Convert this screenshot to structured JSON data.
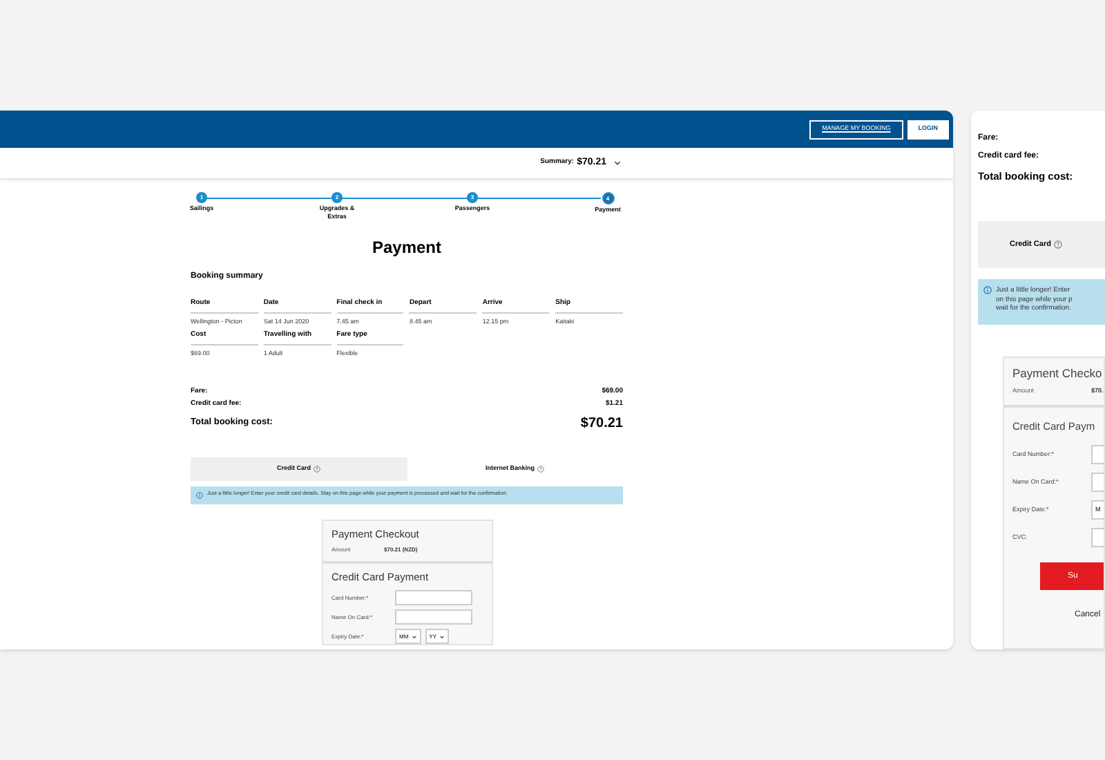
{
  "desktop": {
    "header": {
      "buttons": [
        {
          "label": "MANAGE MY BOOKING",
          "kind": "outline"
        },
        {
          "label": "LOGIN",
          "kind": "solid"
        }
      ]
    },
    "summary": {
      "label": "Summary:",
      "amount": "$70.21"
    },
    "steps": [
      {
        "number": "1",
        "label": "Sailings",
        "selected": false
      },
      {
        "number": "2",
        "label": "Upgrades & Extras",
        "selected": false
      },
      {
        "number": "3",
        "label": "Passengers",
        "selected": false
      },
      {
        "number": "4",
        "label": "Payment",
        "selected": true
      }
    ],
    "title": "Payment",
    "section_title": "Booking summary",
    "details": [
      {
        "label": "Route",
        "value": "Wellington - Picton"
      },
      {
        "label": "Date",
        "value": "Sat 14 Jun 2020"
      },
      {
        "label": "Final check in",
        "value": "7.45 am"
      },
      {
        "label": "Depart",
        "value": "8.45 am"
      },
      {
        "label": "Arrive",
        "value": "12.15 pm"
      },
      {
        "label": "Ship",
        "value": "Kaitaki"
      },
      {
        "label": "Cost",
        "value": "$69.00"
      },
      {
        "label": "Travelling with",
        "value": "1 Adult"
      },
      {
        "label": "Fare type",
        "value": "Flexible"
      }
    ],
    "costs": [
      {
        "label": "Fare:",
        "value": "$69.00",
        "kind": "line"
      },
      {
        "label": "Credit card fee:",
        "value": "$1.21",
        "kind": "line"
      },
      {
        "label": "Total booking cost:",
        "value": "$70.21",
        "kind": "total"
      }
    ],
    "payment_tabs": [
      {
        "label": "Credit Card",
        "selected": true
      },
      {
        "label": "Internet Banking",
        "selected": false
      }
    ],
    "notice": "Just a little longer! Enter your credit card details. Stay on this page while your payment is processed and wait for the confirmation.",
    "checkout": {
      "title": "Payment Checkout",
      "amount_label": "Amount",
      "amount": "$70.21 (NZD)",
      "form_title": "Credit Card Payment",
      "fields": [
        {
          "label": "Card Number:*",
          "kind": "text"
        },
        {
          "label": "Name On Card:*",
          "kind": "text"
        },
        {
          "label": "Expiry Date:*",
          "kind": "date",
          "options": [
            "MM",
            "YY"
          ]
        }
      ]
    }
  },
  "mobile": {
    "costs": [
      {
        "label": "Fare:",
        "kind": "line"
      },
      {
        "label": "Credit card fee:",
        "kind": "line"
      },
      {
        "label": "Total booking cost:",
        "kind": "total"
      }
    ],
    "tab": {
      "label": "Credit Card",
      "selected": true
    },
    "notice_lines": [
      "Just a little longer! Enter",
      "on this page while your p",
      "wait for the confirmation."
    ],
    "checkout": {
      "title": "Payment Checko",
      "amount_label": "Amount",
      "amount": "$70.",
      "form_title": "Credit Card Paym",
      "fields": [
        {
          "label": "Card Number:*",
          "kind": "text"
        },
        {
          "label": "Name On Card:*",
          "kind": "text"
        },
        {
          "label": "Expiry Date:*",
          "kind": "date",
          "options": [
            "M"
          ]
        },
        {
          "label": "CVC:",
          "kind": "text"
        }
      ],
      "submit": "Su",
      "cancel": "Cancel"
    }
  }
}
